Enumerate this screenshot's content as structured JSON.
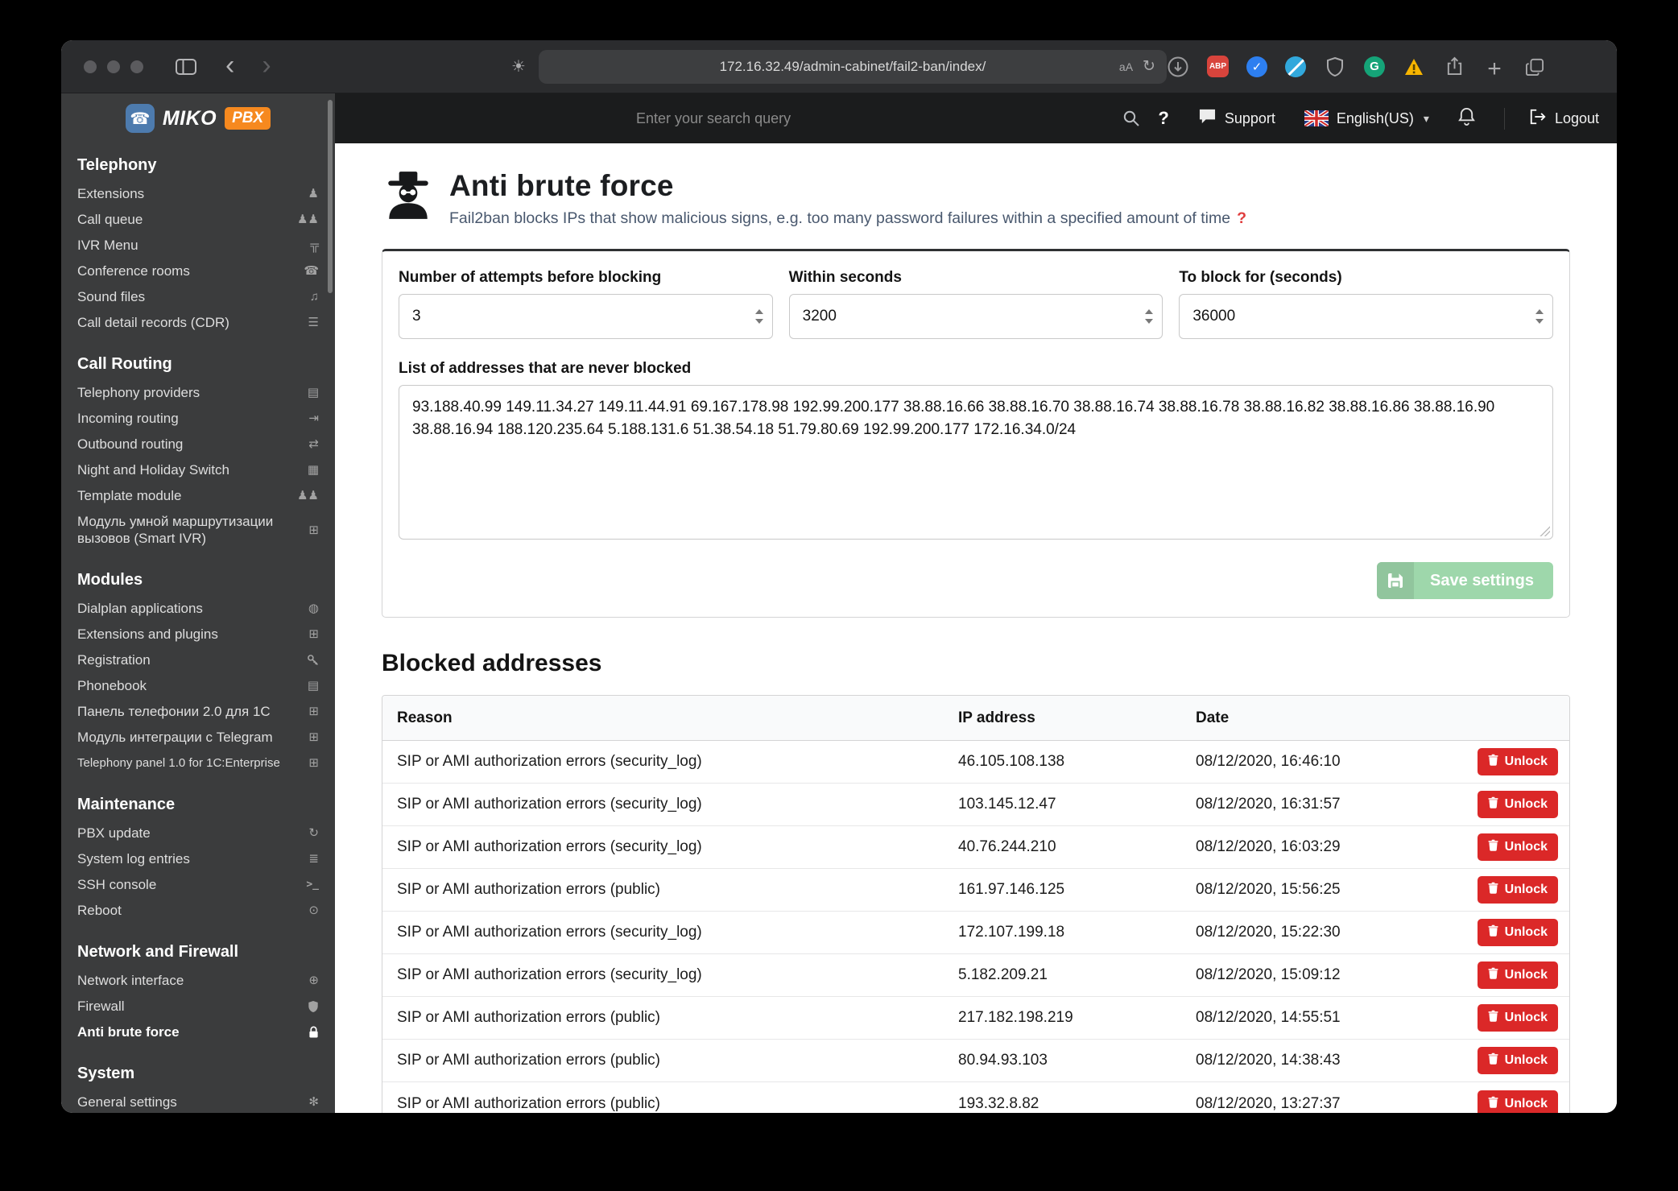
{
  "colors": {
    "sidebar_bg": "#3b3c3d",
    "topbar_bg": "#1b1c1d",
    "brand_orange": "#f6891f",
    "save_green": "#9ed7ab",
    "danger_red": "#db2828",
    "help_red": "#e03e3e"
  },
  "icons": {
    "user": "♟",
    "users": "♟♟",
    "sitemap": "╦",
    "phone": "☎",
    "headphones": "♫",
    "list": "☰",
    "table": "▤",
    "incoming": "⇥",
    "shuffle": "⇄",
    "calendar": "▦",
    "module": "⊞",
    "app": "◍",
    "refresh": "↻",
    "logs": "≣",
    "terminal": ">_",
    "power": "⊙",
    "globe": "⊕",
    "gears": "✻",
    "caret_down": "▾",
    "reload": "↻",
    "text_size": "aA",
    "sun": "☀",
    "back": "‹",
    "forward": "›",
    "plus_tab": "+",
    "check": "✓",
    "phone_logo": "☎"
  },
  "chrome": {
    "url": "172.16.32.49/admin-cabinet/fail2-ban/index/",
    "abp_label": "ABP",
    "grammarly_label": "G"
  },
  "topbar": {
    "search_placeholder": "Enter your search query",
    "help_glyph": "?",
    "support_label": "Support",
    "language": "English(US)",
    "logout_label": "Logout"
  },
  "sidebar": {
    "brand_primary": "MIKO",
    "brand_secondary": "PBX",
    "sections": [
      {
        "title": "Telephony",
        "items": [
          {
            "label": "Extensions",
            "icon": "user"
          },
          {
            "label": "Call queue",
            "icon": "users"
          },
          {
            "label": "IVR Menu",
            "icon": "sitemap"
          },
          {
            "label": "Conference rooms",
            "icon": "phone"
          },
          {
            "label": "Sound files",
            "icon": "headphones"
          },
          {
            "label": "Call detail records (CDR)",
            "icon": "list"
          }
        ]
      },
      {
        "title": "Call Routing",
        "items": [
          {
            "label": "Telephony providers",
            "icon": "table"
          },
          {
            "label": "Incoming routing",
            "icon": "incoming"
          },
          {
            "label": "Outbound routing",
            "icon": "shuffle"
          },
          {
            "label": "Night and Holiday Switch",
            "icon": "calendar"
          },
          {
            "label": "Template module",
            "icon": "users"
          },
          {
            "label": "Модуль умной маршрутизации вызовов (Smart IVR)",
            "icon": "module"
          }
        ]
      },
      {
        "title": "Modules",
        "items": [
          {
            "label": "Dialplan applications",
            "icon": "app"
          },
          {
            "label": "Extensions and plugins",
            "icon": "module"
          },
          {
            "label": "Registration",
            "icon": "key"
          },
          {
            "label": "Phonebook",
            "icon": "table"
          },
          {
            "label": "Панель телефонии 2.0 для 1С",
            "icon": "module"
          },
          {
            "label": "Модуль интеграции с Telegram",
            "icon": "module"
          },
          {
            "label": "Telephony panel 1.0 for 1C:Enterprise",
            "icon": "module"
          }
        ]
      },
      {
        "title": "Maintenance",
        "items": [
          {
            "label": "PBX update",
            "icon": "refresh"
          },
          {
            "label": "System log entries",
            "icon": "logs"
          },
          {
            "label": "SSH console",
            "icon": "terminal"
          },
          {
            "label": "Reboot",
            "icon": "power"
          }
        ]
      },
      {
        "title": "Network and Firewall",
        "items": [
          {
            "label": "Network interface",
            "icon": "globe"
          },
          {
            "label": "Firewall",
            "icon": "shield"
          },
          {
            "label": "Anti brute force",
            "icon": "lock",
            "active": true
          }
        ]
      },
      {
        "title": "System",
        "items": [
          {
            "label": "General settings",
            "icon": "gears"
          }
        ]
      }
    ]
  },
  "main": {
    "page": {
      "title": "Anti brute force",
      "subtitle": "Fail2ban blocks IPs that show malicious signs, e.g. too many password failures within a specified amount of time",
      "help_glyph": "?"
    },
    "form": {
      "attempts": {
        "label": "Number of attempts before blocking",
        "value": "3"
      },
      "within": {
        "label": "Within seconds",
        "value": "3200"
      },
      "block_for": {
        "label": "To block for (seconds)",
        "value": "36000"
      },
      "whitelist": {
        "label": "List of addresses that are never blocked",
        "value": "93.188.40.99 149.11.34.27 149.11.44.91 69.167.178.98 192.99.200.177 38.88.16.66 38.88.16.70 38.88.16.74 38.88.16.78 38.88.16.82 38.88.16.86 38.88.16.90 38.88.16.94 188.120.235.64 5.188.131.6 51.38.54.18 51.79.80.69 192.99.200.177 172.16.34.0/24"
      },
      "save_label": "Save settings"
    },
    "blocked": {
      "title": "Blocked addresses",
      "columns": [
        "Reason",
        "IP address",
        "Date"
      ],
      "unlock_label": "Unlock",
      "rows": [
        {
          "reason": "SIP or AMI authorization errors (security_log)",
          "ip": "46.105.108.138",
          "date": "08/12/2020, 16:46:10"
        },
        {
          "reason": "SIP or AMI authorization errors (security_log)",
          "ip": "103.145.12.47",
          "date": "08/12/2020, 16:31:57"
        },
        {
          "reason": "SIP or AMI authorization errors (security_log)",
          "ip": "40.76.244.210",
          "date": "08/12/2020, 16:03:29"
        },
        {
          "reason": "SIP or AMI authorization errors (public)",
          "ip": "161.97.146.125",
          "date": "08/12/2020, 15:56:25"
        },
        {
          "reason": "SIP or AMI authorization errors (security_log)",
          "ip": "172.107.199.18",
          "date": "08/12/2020, 15:22:30"
        },
        {
          "reason": "SIP or AMI authorization errors (security_log)",
          "ip": "5.182.209.21",
          "date": "08/12/2020, 15:09:12"
        },
        {
          "reason": "SIP or AMI authorization errors (public)",
          "ip": "217.182.198.219",
          "date": "08/12/2020, 14:55:51"
        },
        {
          "reason": "SIP or AMI authorization errors (public)",
          "ip": "80.94.93.103",
          "date": "08/12/2020, 14:38:43"
        },
        {
          "reason": "SIP or AMI authorization errors (public)",
          "ip": "193.32.8.82",
          "date": "08/12/2020, 13:27:37"
        }
      ]
    }
  }
}
